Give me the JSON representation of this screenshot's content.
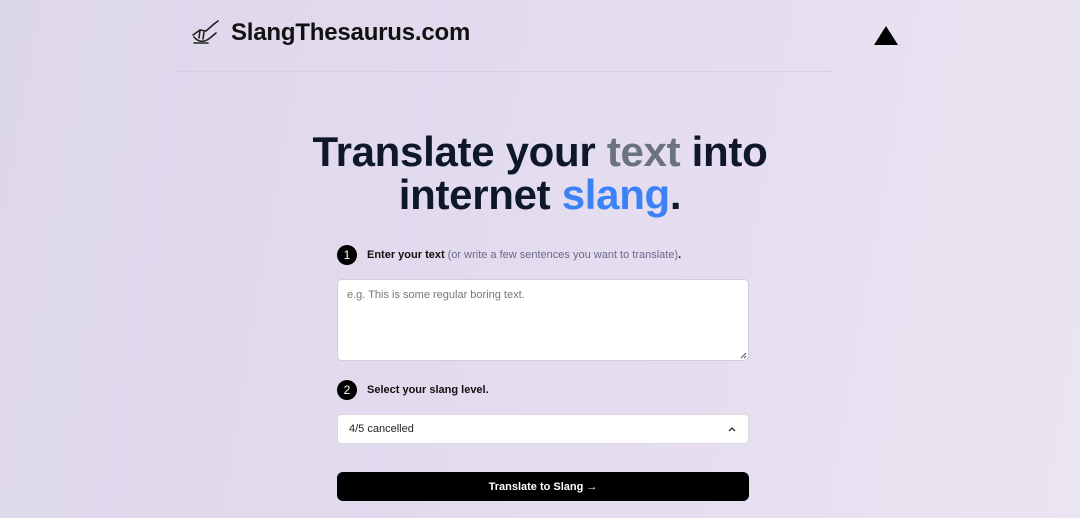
{
  "header": {
    "brand": "SlangThesaurus.com",
    "logo_icon": "writing-hand-icon",
    "theme_toggle_icon": "triangle-up-icon"
  },
  "hero": {
    "part1": "Translate your ",
    "highlight1": "text",
    "part2": " into",
    "part3": "internet ",
    "highlight2": "slang",
    "part4": "."
  },
  "step1": {
    "number": "1",
    "label": "Enter your text",
    "hint": "(or write a few sentences you want to translate)",
    "suffix": "."
  },
  "input": {
    "placeholder": "e.g. This is some regular boring text.",
    "value": ""
  },
  "step2": {
    "number": "2",
    "label": "Select your slang level."
  },
  "slang_select": {
    "selected": "4/5 cancelled",
    "icon": "chevron-up-icon"
  },
  "cta": {
    "label": "Translate to Slang →"
  },
  "colors": {
    "accent": "#3b82f6",
    "muted": "#6b7280",
    "button": "#000000"
  }
}
